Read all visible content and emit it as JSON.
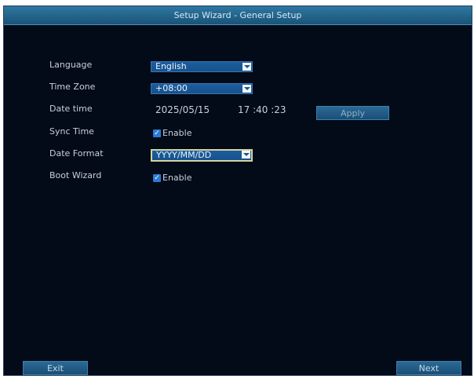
{
  "window": {
    "title": "Setup Wizard - General Setup"
  },
  "fields": {
    "language": {
      "label": "Language",
      "value": "English"
    },
    "timezone": {
      "label": "Time Zone",
      "value": "+08:00"
    },
    "datetime": {
      "label": "Date time",
      "date": "2025/05/15",
      "time": "17 :40 :23",
      "apply_label": "Apply"
    },
    "sync_time": {
      "label": "Sync Time",
      "checked": true,
      "option_label": "Enable"
    },
    "date_format": {
      "label": "Date Format",
      "value": "YYYY/MM/DD"
    },
    "boot_wizard": {
      "label": "Boot Wizard",
      "checked": true,
      "option_label": "Enable"
    }
  },
  "footer": {
    "exit_label": "Exit",
    "next_label": "Next"
  },
  "icons": {
    "dropdown": "chevron-down-icon",
    "check": "check-icon"
  },
  "colors": {
    "background": "#030a18",
    "titlebar": "#2f77a1",
    "select": "#1c5d9e",
    "checkbox": "#2a7bd1",
    "highlight_border": "#d2d4a2"
  }
}
